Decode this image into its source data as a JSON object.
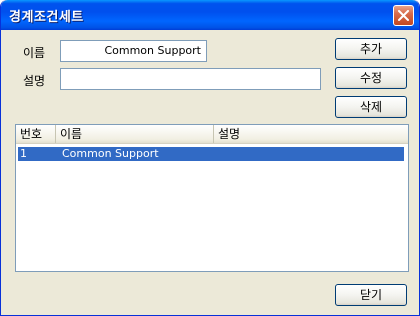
{
  "window": {
    "title": "경계조건세트"
  },
  "form": {
    "name_label": "이름",
    "name_value": "Common Support",
    "desc_label": "설명",
    "desc_value": ""
  },
  "buttons": {
    "add": "추가",
    "modify": "수정",
    "delete": "삭제",
    "close": "닫기"
  },
  "list": {
    "columns": [
      "번호",
      "이름",
      "설명"
    ],
    "rows": [
      {
        "number": "1",
        "name": "Common Support",
        "description": "",
        "selected": true
      }
    ]
  },
  "colors": {
    "titlebar": "#0054e3",
    "selection": "#316ac5",
    "dialog_bg": "#ece9d8"
  }
}
